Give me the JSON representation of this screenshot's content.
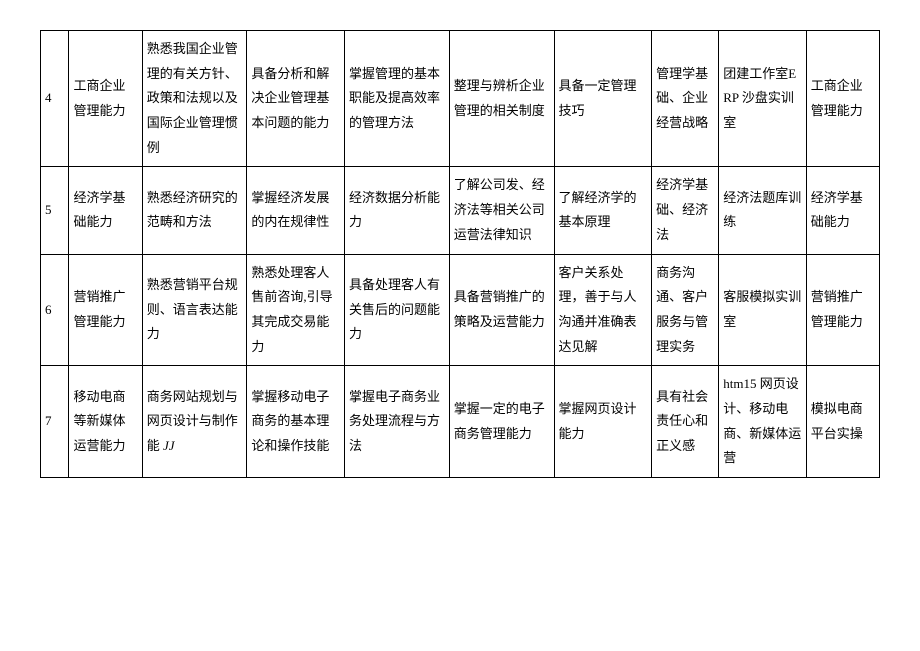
{
  "rows": [
    {
      "num": "4",
      "c1": "工商企业管理能力",
      "c2": "熟悉我国企业管理的有关方针、政策和法规以及国际企业管理惯例",
      "c3": "具备分析和解决企业管理基本问题的能力",
      "c4": "掌握管理的基本职能及提高效率的管理方法",
      "c5": "整理与辨析企业管理的相关制度",
      "c6": "具备一定管理技巧",
      "c7": "管理学基础、企业经营战略",
      "c8": "团建工作室ERP 沙盘实训室",
      "c9": "工商企业管理能力"
    },
    {
      "num": "5",
      "c1": "经济学基础能力",
      "c2": "熟悉经济研究的范畴和方法",
      "c3": "掌握经济发展的内在规律性",
      "c4": "经济数据分析能力",
      "c5": "了解公司发、经济法等相关公司运营法律知识",
      "c6": "了解经济学的基本原理",
      "c7": "经济学基础、经济法",
      "c8": "经济法题库训练",
      "c9": "经济学基础能力"
    },
    {
      "num": "6",
      "c1": "营销推广管理能力",
      "c2": "熟悉营销平台规则、语言表达能力",
      "c3": "熟悉处理客人售前咨询,引导其完成交易能力",
      "c4": "具备处理客人有关售后的问题能力",
      "c5": "具备营销推广的策略及运营能力",
      "c6": "客户关系处理，善于与人沟通并准确表达见解",
      "c7": "商务沟通、客户服务与管理实务",
      "c8": "客服模拟实训室",
      "c9": "营销推广管理能力"
    },
    {
      "num": "7",
      "c1": "移动电商等新媒体运营能力",
      "c2_a": "商务网站规划与网页设计与制作能 ",
      "c2_b": "JJ",
      "c3": "掌握移动电子商务的基本理论和操作技能",
      "c4": "掌握电子商务业务处理流程与方法",
      "c5": "掌握一定的电子商务管理能力",
      "c6": "掌握网页设计能力",
      "c7": "具有社会责任心和正义感",
      "c8": "htm15 网页设计、移动电商、新媒体运营",
      "c9": "模拟电商平台实操"
    }
  ]
}
